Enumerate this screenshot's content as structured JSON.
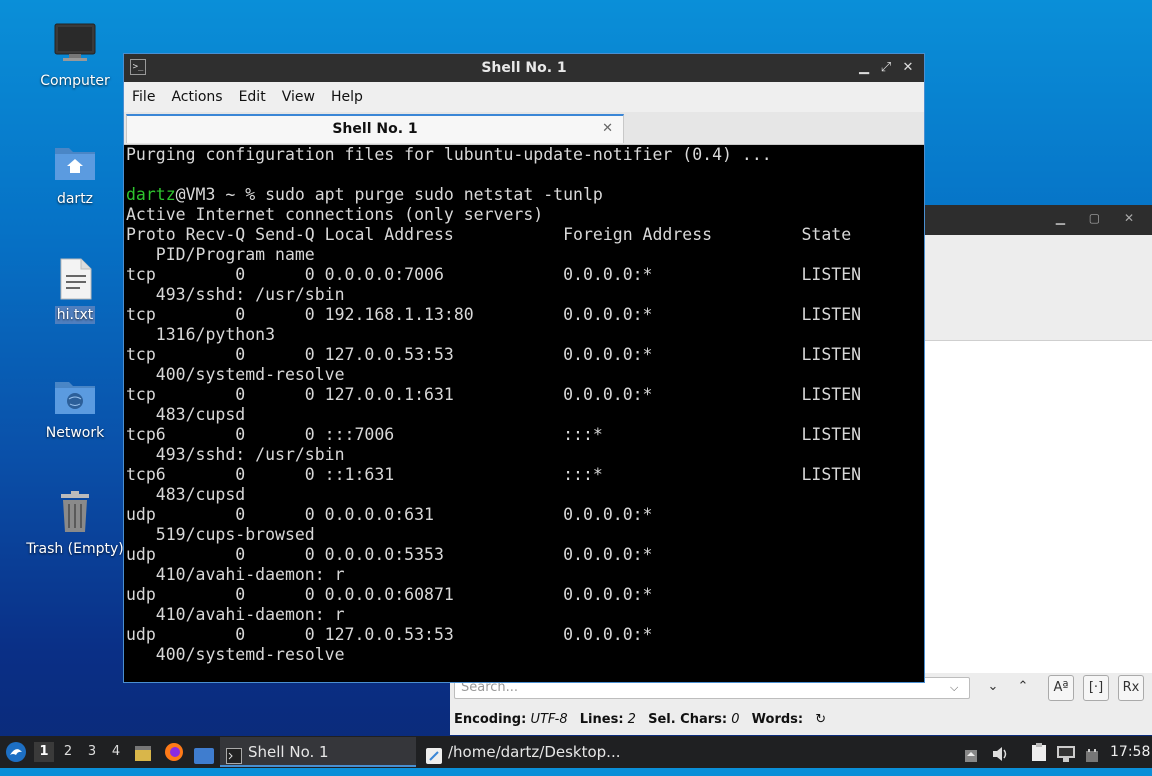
{
  "desktop": {
    "icons": [
      {
        "label": "Computer",
        "icon": "computer-icon"
      },
      {
        "label": "dartz",
        "icon": "home-folder-icon"
      },
      {
        "label": "hi.txt",
        "icon": "text-file-icon"
      },
      {
        "label": "Network",
        "icon": "network-folder-icon"
      },
      {
        "label": "Trash (Empty)",
        "icon": "trash-icon"
      }
    ]
  },
  "terminal": {
    "title": "Shell No. 1",
    "menu": [
      "File",
      "Actions",
      "Edit",
      "View",
      "Help"
    ],
    "tab_label": "Shell No. 1",
    "user": "dartz",
    "lines": [
      "Purging configuration files for lubuntu-update-notifier (0.4) ...",
      "",
      "@VM3 ~ % sudo apt purge sudo netstat -tunlp",
      "Active Internet connections (only servers)",
      "Proto Recv-Q Send-Q Local Address           Foreign Address         State",
      "   PID/Program name",
      "tcp        0      0 0.0.0.0:7006            0.0.0.0:*               LISTEN",
      "   493/sshd: /usr/sbin",
      "tcp        0      0 192.168.1.13:80         0.0.0.0:*               LISTEN",
      "   1316/python3",
      "tcp        0      0 127.0.0.53:53           0.0.0.0:*               LISTEN",
      "   400/systemd-resolve",
      "tcp        0      0 127.0.0.1:631           0.0.0.0:*               LISTEN",
      "   483/cupsd",
      "tcp6       0      0 :::7006                 :::*                    LISTEN",
      "   493/sshd: /usr/sbin",
      "tcp6       0      0 ::1:631                 :::*                    LISTEN",
      "   483/cupsd",
      "udp        0      0 0.0.0.0:631             0.0.0.0:*",
      "   519/cups-browsed",
      "udp        0      0 0.0.0.0:5353            0.0.0.0:*",
      "   410/avahi-daemon: r",
      "udp        0      0 0.0.0.0:60871           0.0.0.0:*",
      "   410/avahi-daemon: r",
      "udp        0      0 127.0.0.53:53           0.0.0.0:*",
      "   400/systemd-resolve"
    ]
  },
  "editor": {
    "search_placeholder": "Search...",
    "status": {
      "encoding_label": "Encoding:",
      "encoding_value": "UTF-8",
      "lines_label": "Lines:",
      "lines_value": "2",
      "sel_label": "Sel. Chars:",
      "sel_value": "0",
      "words_label": "Words:"
    }
  },
  "taskbar": {
    "workspaces": [
      "1",
      "2",
      "3",
      "4"
    ],
    "active_workspace": "1",
    "tasks": [
      {
        "label": "Shell No. 1",
        "active": true
      },
      {
        "label": "/home/dartz/Desktop...",
        "active": false
      }
    ],
    "clock": "17:58"
  },
  "colors": {
    "terminal_user": "#2ec42e",
    "accent": "#4a8fd1"
  }
}
